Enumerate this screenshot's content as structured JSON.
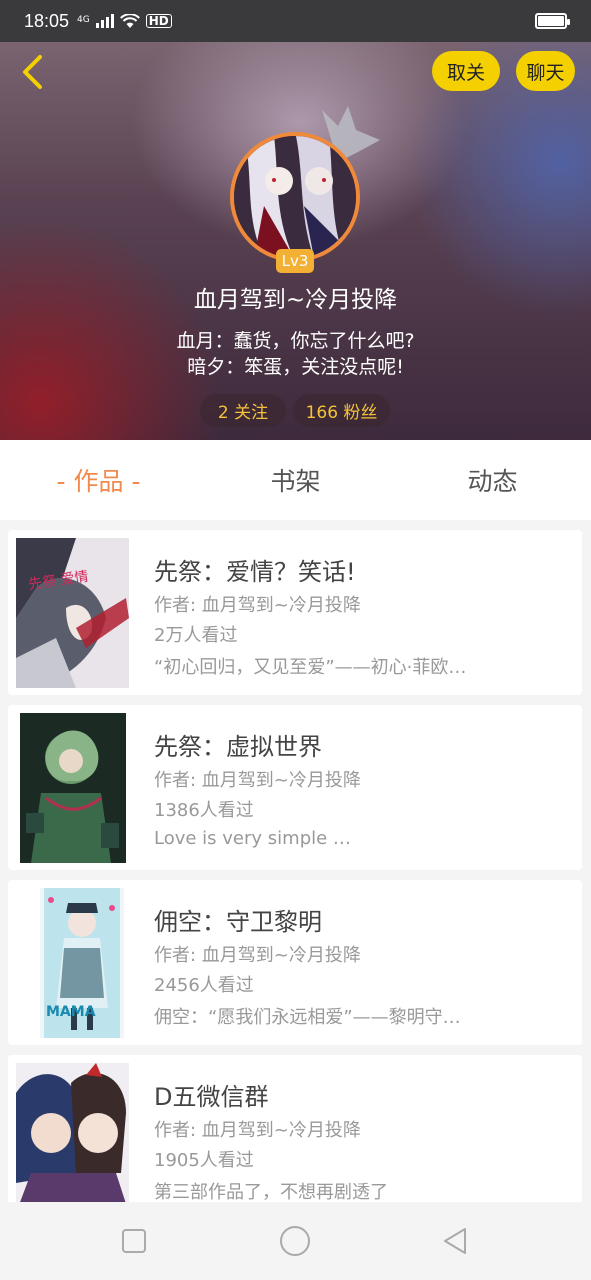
{
  "status_bar": {
    "time": "18:05",
    "network": "4G",
    "hd": "HD"
  },
  "header": {
    "unfollow_label": "取关",
    "chat_label": "聊天",
    "level": "Lv3",
    "username": "血月驾到~冷月投降",
    "bio_line1": "血月：蠢货，你忘了什么吧?",
    "bio_line2": "暗夕：笨蛋，关注没点呢!",
    "following": "2 关注",
    "fans": "166 粉丝"
  },
  "tabs": [
    {
      "label": "- 作品 -",
      "active": true
    },
    {
      "label": "书架",
      "active": false
    },
    {
      "label": "动态",
      "active": false
    }
  ],
  "works": [
    {
      "title": "先祭：爱情？笑话!",
      "author": "作者: 血月驾到~冷月投降",
      "views": "2万人看过",
      "desc": "“初心回归，又见至爱”——初心·菲欧…"
    },
    {
      "title": "先祭：虚拟世界",
      "author": "作者: 血月驾到~冷月投降",
      "views": "1386人看过",
      "desc": "Love is very simple …"
    },
    {
      "title": "佣空：守卫黎明",
      "author": "作者: 血月驾到~冷月投降",
      "views": "2456人看过",
      "desc": "佣空：“愿我们永远相爱”——黎明守卫者…"
    },
    {
      "title": "D五微信群",
      "author": "作者: 血月驾到~冷月投降",
      "views": "1905人看过",
      "desc": "第三部作品了，不想再剧透了"
    }
  ],
  "colors": {
    "accent": "#f08a50",
    "button_yellow": "#f5d000",
    "stat_text": "#f5c23a",
    "level_badge": "#f2b035"
  }
}
